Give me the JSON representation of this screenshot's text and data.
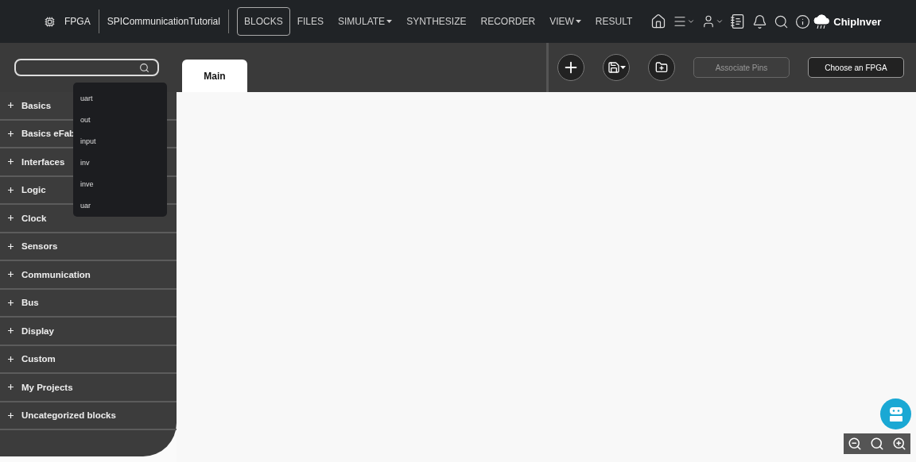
{
  "header": {
    "project_type": "FPGA",
    "project_name": "SPICommunicationTutorial",
    "nav": [
      {
        "label": "BLOCKS",
        "selected": true,
        "dropdown": false
      },
      {
        "label": "FILES",
        "selected": false,
        "dropdown": false
      },
      {
        "label": "SIMULATE",
        "selected": false,
        "dropdown": true
      },
      {
        "label": "SYNTHESIZE",
        "selected": false,
        "dropdown": false
      },
      {
        "label": "RECORDER",
        "selected": false,
        "dropdown": false
      },
      {
        "label": "VIEW",
        "selected": false,
        "dropdown": true
      },
      {
        "label": "RESULT",
        "selected": false,
        "dropdown": false
      }
    ],
    "logo": "ChipInver"
  },
  "search": {
    "suggestions": [
      "uart",
      "out",
      "input",
      "inv",
      "inve",
      "uar"
    ]
  },
  "tabs": [
    {
      "label": "Main",
      "selected": true
    }
  ],
  "toolbar": {
    "buttons": [
      {
        "label": "Associate Pins",
        "disabled": true
      },
      {
        "label": "Choose an FPGA",
        "disabled": false
      }
    ]
  },
  "sidebar": {
    "items": [
      {
        "label": "Basics"
      },
      {
        "label": "Basics eFab"
      },
      {
        "label": "Interfaces"
      },
      {
        "label": "Logic"
      },
      {
        "label": "Clock"
      },
      {
        "label": "Sensors"
      },
      {
        "label": "Communication"
      },
      {
        "label": "Bus"
      },
      {
        "label": "Display"
      },
      {
        "label": "Custom"
      },
      {
        "label": "My Projects"
      },
      {
        "label": "Uncategorized blocks"
      }
    ]
  }
}
